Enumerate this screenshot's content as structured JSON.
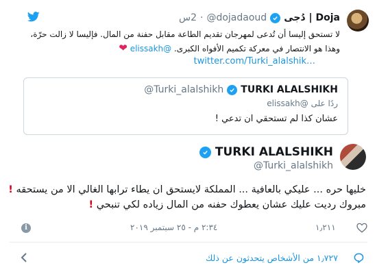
{
  "reply": {
    "author_name": "Doja | دُجى",
    "handle": "@dojadaoud",
    "time": "2س",
    "separator": "·",
    "text_line1": "لا تستحق إليسا أن تُدعى لمهرجان تقديم الطاعة مقابل حفنة من المال. فإليسا لا زالت حرّة،",
    "text_line2_prefix": "وهذا هو الانتصار في معركة تكميم الأفواه الكبرى.",
    "text_line2_mention": "@elissakh",
    "link": "twitter.com/Turki_alalshik…"
  },
  "quote": {
    "author_name": "TURKI ALALSHIKH",
    "handle": "@Turki_alalshikh",
    "reply_prefix": "ردًا على",
    "reply_mention": "@elissakh",
    "text": "عشان كذا لم تستحقي ان تدعي !"
  },
  "tweet": {
    "author_name": "TURKI ALALSHIKH",
    "handle": "@Turki_alalshikh",
    "text_line1": "خليها حره ... عليكي بالعافية ... المملكة لايستحق ان يطاء ترابها الغالي الا من يستحقه",
    "text_line2": "مبروك رديت عليك عشان يعطوك حفنه من المال زياده لكي تنبحي",
    "exclamation": "!",
    "timestamp": "٢:٣٤ م - ٢٥ سبتمبر ٢٠١٩",
    "likes": "١٫٢١١",
    "conversation": "١٫٧٢٧ من الأشخاص يتحدثون عن ذلك"
  },
  "icons": {
    "bird": "twitter-bird-icon",
    "verified": "verified-badge-icon",
    "info": "info-icon",
    "heart": "heart-icon",
    "chevron": "chevron-left-icon",
    "bubble": "chat-bubble-icon"
  },
  "colors": {
    "link": "#1b95e0",
    "verified": "#1da1f2",
    "secondary_text": "#657786",
    "heart_emoji": "#e0245e",
    "exclamation": "#d0021b"
  }
}
